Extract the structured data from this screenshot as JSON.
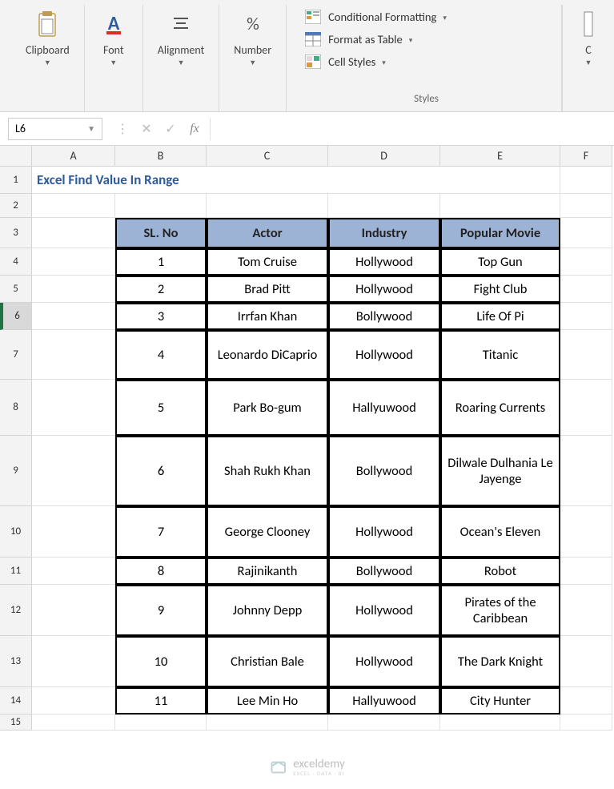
{
  "ribbon": {
    "clipboard": {
      "label": "Clipboard"
    },
    "font": {
      "label": "Font"
    },
    "alignment": {
      "label": "Alignment"
    },
    "number": {
      "label": "Number"
    },
    "styles": {
      "conditional": "Conditional Formatting",
      "format_table": "Format as Table",
      "cell_styles": "Cell Styles",
      "title": "Styles"
    },
    "side": {
      "letter": "C"
    }
  },
  "formula_bar": {
    "namebox": "L6",
    "value": ""
  },
  "columns": [
    "",
    "A",
    "B",
    "C",
    "D",
    "E",
    "F"
  ],
  "title_text": "Excel Find Value In Range",
  "table": {
    "headers": [
      "SL. No",
      "Actor",
      "Industry",
      "Popular Movie"
    ],
    "rows": [
      {
        "sl": "1",
        "actor": "Tom Cruise",
        "industry": "Hollywood",
        "movie": "Top Gun"
      },
      {
        "sl": "2",
        "actor": "Brad Pitt",
        "industry": "Hollywood",
        "movie": "Fight Club"
      },
      {
        "sl": "3",
        "actor": "Irrfan Khan",
        "industry": "Bollywood",
        "movie": "Life Of Pi"
      },
      {
        "sl": "4",
        "actor": "Leonardo DiCaprio",
        "industry": "Hollywood",
        "movie": "Titanic"
      },
      {
        "sl": "5",
        "actor": "Park Bo-gum",
        "industry": "Hallyuwood",
        "movie": "Roaring Currents"
      },
      {
        "sl": "6",
        "actor": "Shah Rukh Khan",
        "industry": "Bollywood",
        "movie": "Dilwale Dulhania Le Jayenge"
      },
      {
        "sl": "7",
        "actor": "George Clooney",
        "industry": "Hollywood",
        "movie": "Ocean's Eleven"
      },
      {
        "sl": "8",
        "actor": "Rajinikanth",
        "industry": "Bollywood",
        "movie": "Robot"
      },
      {
        "sl": "9",
        "actor": "Johnny Depp",
        "industry": "Hollywood",
        "movie": "Pirates of the Caribbean"
      },
      {
        "sl": "10",
        "actor": "Christian Bale",
        "industry": "Hollywood",
        "movie": "The Dark Knight"
      },
      {
        "sl": "11",
        "actor": "Lee Min Ho",
        "industry": "Hallyuwood",
        "movie": "City Hunter"
      }
    ]
  },
  "row_numbers": [
    "1",
    "2",
    "3",
    "4",
    "5",
    "6",
    "7",
    "8",
    "9",
    "10",
    "11",
    "12",
    "13",
    "14",
    "15"
  ],
  "selected_row": "6",
  "watermark": {
    "main": "exceldemy",
    "sub": "EXCEL · DATA · BI"
  }
}
